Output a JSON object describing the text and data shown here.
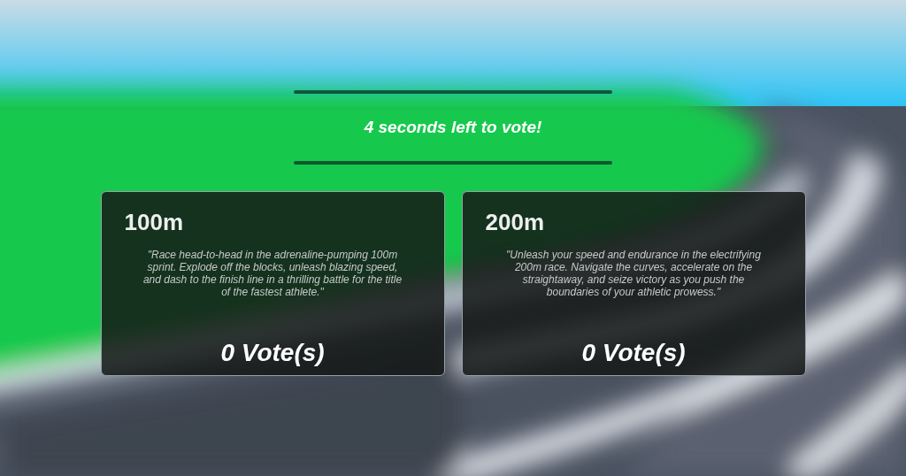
{
  "timer": {
    "text": "4 seconds left to vote!"
  },
  "options": [
    {
      "title": "100m",
      "description": "\"Race head-to-head in the adrenaline-pumping 100m sprint. Explode off the blocks, unleash blazing speed, and dash to the finish line in a thrilling battle for the title of the fastest athlete.\"",
      "votes": "0 Vote(s)"
    },
    {
      "title": "200m",
      "description": "\"Unleash your speed and endurance in the electrifying 200m race. Navigate the curves, accelerate on the straightaway, and seize victory as you push the boundaries of your athletic prowess.\"",
      "votes": "0 Vote(s)"
    }
  ]
}
